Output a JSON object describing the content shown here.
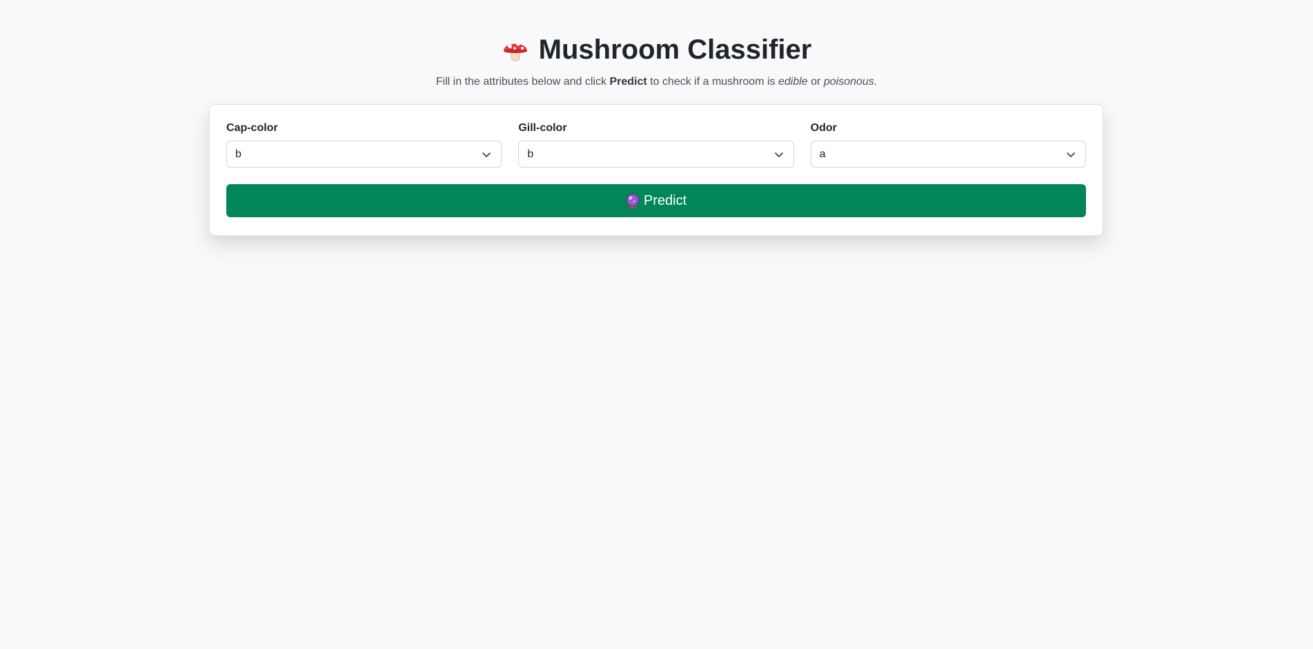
{
  "header": {
    "title": "Mushroom Classifier",
    "title_icon": "mushroom-icon",
    "subtitle_part1": "Fill in the attributes below and click ",
    "subtitle_bold": "Predict",
    "subtitle_part2": " to check if a mushroom is ",
    "subtitle_italic1": "edible",
    "subtitle_part3": " or ",
    "subtitle_italic2": "poisonous",
    "subtitle_part4": "."
  },
  "form": {
    "fields": [
      {
        "label": "Cap-color",
        "value": "b"
      },
      {
        "label": "Gill-color",
        "value": "b"
      },
      {
        "label": "Odor",
        "value": "a"
      }
    ],
    "predict_label": "Predict",
    "predict_icon": "crystal-ball-icon"
  },
  "colors": {
    "background": "#f8f9fa",
    "button": "#028657",
    "text": "#212529"
  }
}
